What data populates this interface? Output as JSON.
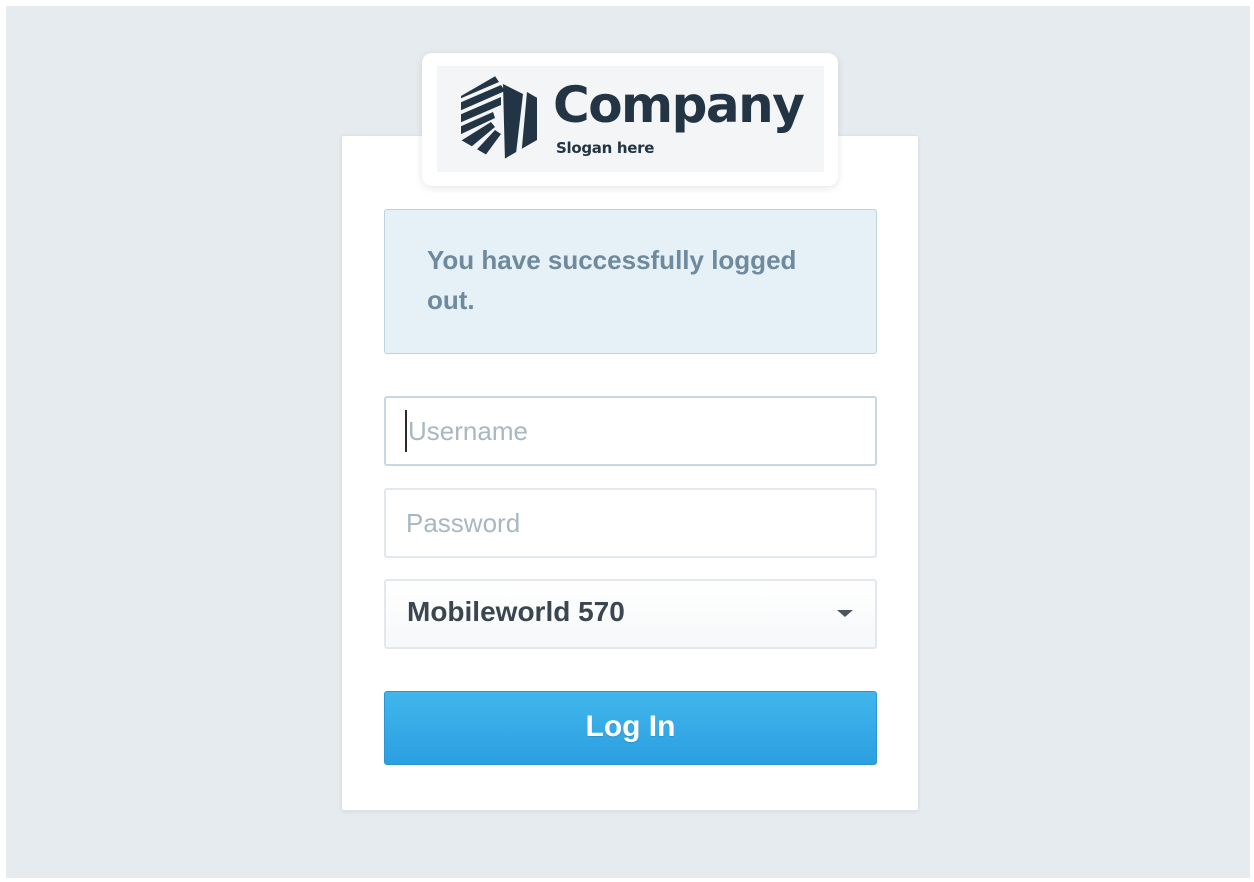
{
  "brand": {
    "name": "Company",
    "slogan": "Slogan here",
    "logo_icon": "striped-hexagon-logo-icon",
    "color": "#233544"
  },
  "alert": {
    "message": "You have successfully logged out."
  },
  "form": {
    "username_placeholder": "Username",
    "password_placeholder": "Password",
    "location_selected": "Mobileworld 570",
    "login_label": "Log In"
  },
  "colors": {
    "background": "#e6ebef",
    "alert_bg": "#e5f0f7",
    "alert_text": "#6f8a9d",
    "button": "#2ea8e5"
  }
}
